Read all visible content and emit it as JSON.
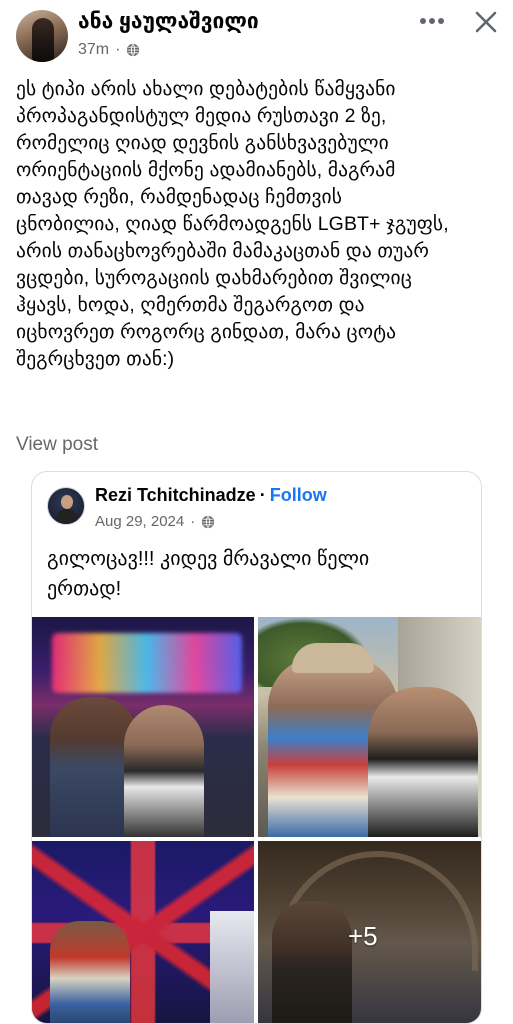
{
  "post": {
    "author": "ანა ყაულაშვილი",
    "time": "37m",
    "separator": "·",
    "privacy_icon": "globe-icon",
    "more_icon": "more-horizontal-icon",
    "close_icon": "close-icon",
    "text_lines": [
      "ეს ტიპი არის ახალი დებატების წამყვანი",
      "პროპაგანდისტულ მედია რუსთავი 2 ზე,",
      "რომელიც ღიად დევნის განსხვავებული",
      "ორიენტაციის მქონე ადამიანებს, მაგრამ",
      "თავად რეზი, რამდენადაც ჩემთვის",
      "ცნობილია, ღიად წარმოადგენს LGBT+ ჯგუფს,",
      "არის თანაცხოვრებაში მამაკაცთან და თუარ",
      "ვცდები, სუროგაციის დახმარებით შვილიც",
      "ჰყავს, ხოდა, ღმერთმა შეგარგოთ და",
      "იცხოვრეთ როგორც გინდათ, მარა ცოტა",
      "შეგრცხვეთ თან:)"
    ],
    "view_post_label": "View post"
  },
  "shared": {
    "author": "Rezi Tchitchinadze",
    "dot": "·",
    "follow_label": "Follow",
    "date": "Aug 29, 2024",
    "separator": "·",
    "privacy_icon": "globe-icon",
    "text_lines": [
      "გილოცავ!!! კიდევ მრავალი წელი",
      "ერთად!"
    ],
    "more_photos_label": "+5"
  },
  "colors": {
    "link_blue": "#1877f2",
    "secondary_text": "#65676b",
    "primary_text": "#050505",
    "card_border": "#dcdde1"
  }
}
